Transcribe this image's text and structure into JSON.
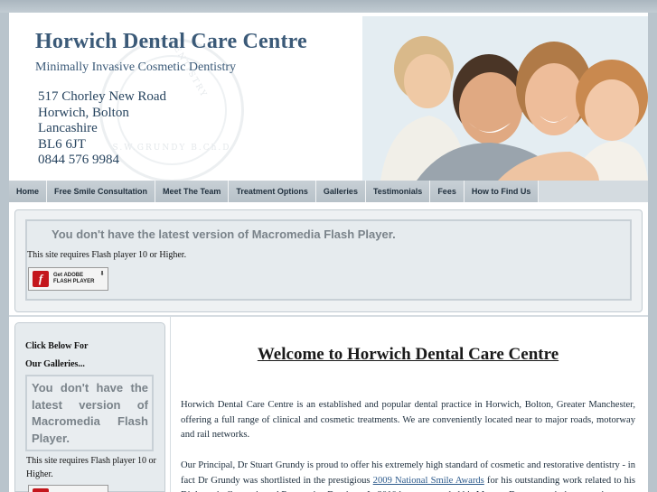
{
  "header": {
    "title": "Horwich Dental Care Centre",
    "tagline": "Minimally Invasive Cosmetic Dentistry",
    "address": [
      "517 Chorley New Road",
      "Horwich, Bolton",
      "Lancashire",
      "BL6 6JT",
      "0844 576 9984"
    ],
    "seal_text": "S.W.GRUNDY B.Ch.D",
    "seal_top_text": "DENTISTRY"
  },
  "nav": {
    "items": [
      {
        "label": "Home"
      },
      {
        "label": "Free Smile Consultation"
      },
      {
        "label": "Meet The Team"
      },
      {
        "label": "Treatment Options"
      },
      {
        "label": "Galleries"
      },
      {
        "label": "Testimonials"
      },
      {
        "label": "Fees"
      },
      {
        "label": "How to Find Us"
      }
    ]
  },
  "flash_banner": {
    "message": "You don't have the latest version of Macromedia Flash Player.",
    "note": "This site requires Flash player 10 or Higher.",
    "button_line1": "Get ADOBE",
    "button_line2": "FLASH PLAYER"
  },
  "sidebar": {
    "heading_line1": "Click Below For",
    "heading_line2": "Our Galleries...",
    "flash_message": "You don't have the latest version of Macromedia Flash Player.",
    "flash_note": "This site requires Flash player 10 or Higher."
  },
  "main": {
    "welcome": "Welcome to Horwich Dental Care Centre",
    "para1": "Horwich Dental Care Centre is an established and popular dental practice in Horwich, Bolton, Greater Manchester, offering a full range of clinical and cosmetic treatments. We are conveniently located near to major roads, motorway and rail networks.",
    "para2_before": "Our Principal, Dr Stuart Grundy is proud to offer his extremely high standard of cosmetic and restorative dentistry - in fact Dr Grundy was shortlisted in the prestigious ",
    "para2_link": "2009 National Smile Awards",
    "para2_after": " for his outstanding work related to his Diploma in Cosmetic and Restorative Dentistry. In 2010 he was awarded his Masters Degree, again in cosmetic"
  },
  "colors": {
    "title": "#3b5a78",
    "nav_bg": "#b7c1c8",
    "page_bg": "#b9c4cc",
    "flash_red": "#c4161c"
  },
  "icons": [
    "adobe-flash-logo-icon",
    "download-arrow-icon",
    "family-photo"
  ]
}
